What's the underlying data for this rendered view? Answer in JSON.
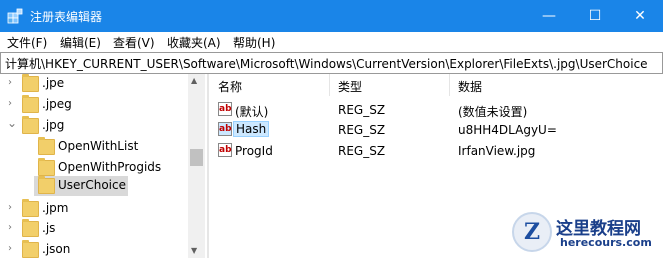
{
  "window": {
    "title": "注册表编辑器",
    "minimize": "—",
    "maximize": "☐",
    "close": "✕"
  },
  "menu": [
    "文件(F)",
    "编辑(E)",
    "查看(V)",
    "收藏夹(A)",
    "帮助(H)"
  ],
  "address": "计算机\\HKEY_CURRENT_USER\\Software\\Microsoft\\Windows\\CurrentVersion\\Explorer\\FileExts\\.jpg\\UserChoice",
  "tree": [
    {
      "label": ".jpe",
      "chevron": "›"
    },
    {
      "label": ".jpeg",
      "chevron": "›"
    },
    {
      "label": ".jpg",
      "chevron": "⌄"
    },
    {
      "label": "OpenWithList",
      "chevron": ""
    },
    {
      "label": "OpenWithProgids",
      "chevron": ""
    },
    {
      "label": "UserChoice",
      "chevron": "",
      "selected": true
    },
    {
      "label": ".jpm",
      "chevron": "›"
    },
    {
      "label": ".js",
      "chevron": "›"
    },
    {
      "label": ".json",
      "chevron": "›"
    }
  ],
  "columns": [
    "名称",
    "类型",
    "数据"
  ],
  "values": [
    {
      "name": "(默认)",
      "type": "REG_SZ",
      "data": "(数值未设置)"
    },
    {
      "name": "Hash",
      "type": "REG_SZ",
      "data": "u8HH4DLAgyU="
    },
    {
      "name": "ProgId",
      "type": "REG_SZ",
      "data": "IrfanView.jpg"
    }
  ],
  "icons": {
    "app": "registry-icon",
    "folder": "folder-icon",
    "value": "string-value-icon"
  },
  "colors": {
    "titlebar": "#1a85e8",
    "selection": "#cce8ff"
  },
  "watermark": {
    "title": "这里教程网",
    "subtitle": "herecours.com",
    "logo": "Z"
  }
}
